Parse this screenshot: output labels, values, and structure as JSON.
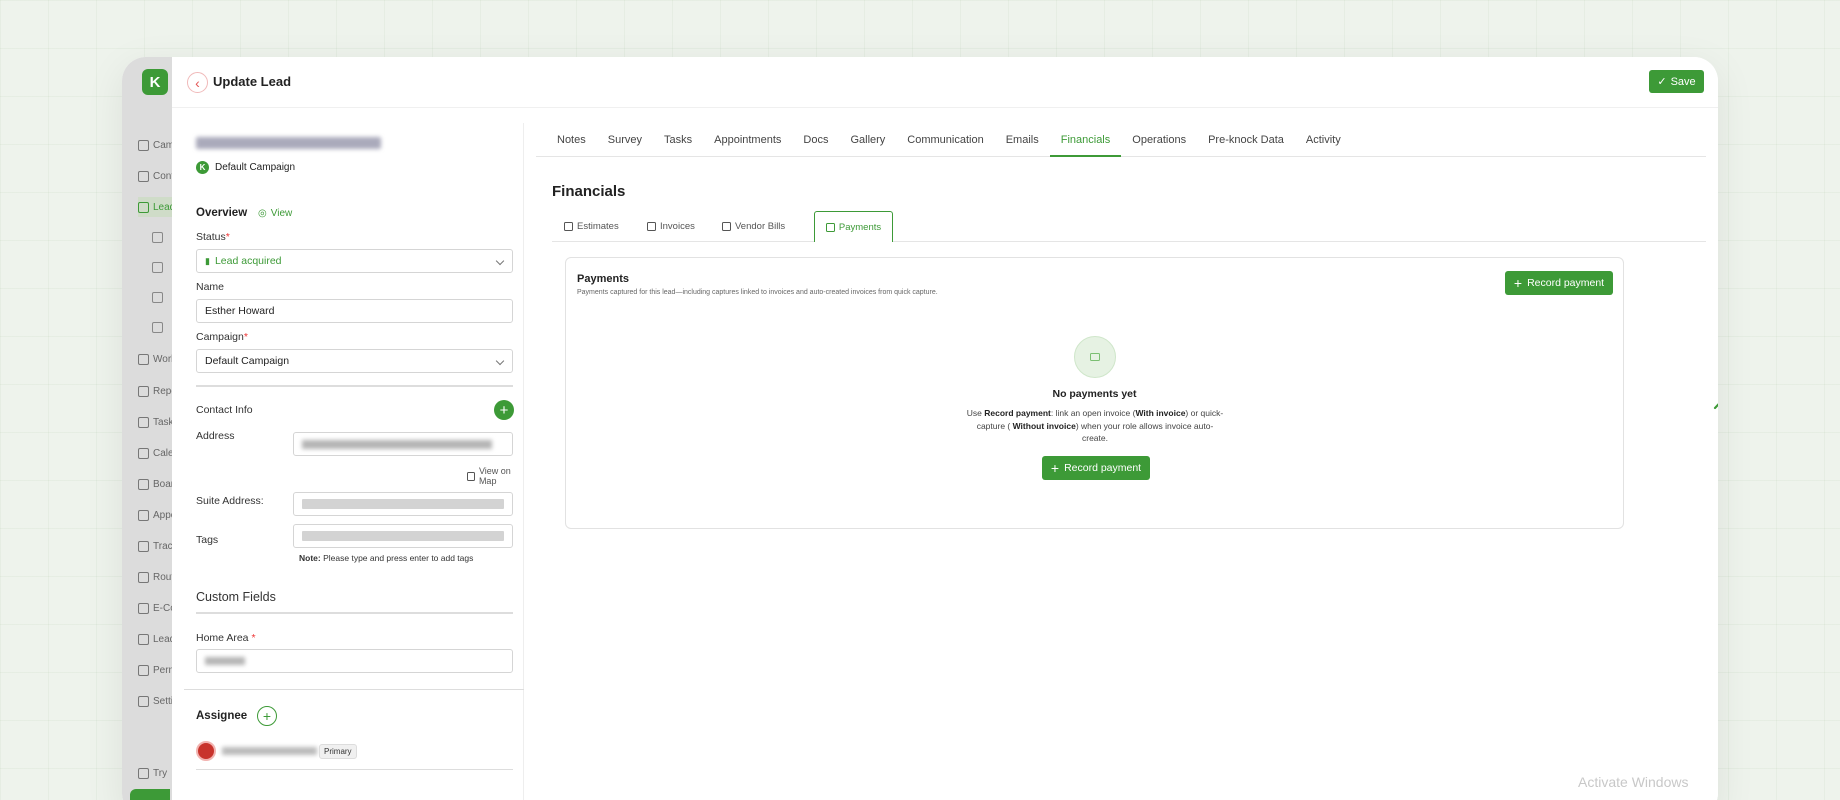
{
  "header": {
    "title": "Update Lead",
    "save_label": "Save"
  },
  "sidebar": {
    "items": [
      {
        "label": "Campaigns"
      },
      {
        "label": "Contacts"
      },
      {
        "label": "Leads"
      },
      {
        "label": "Work Orders"
      },
      {
        "label": "Reports"
      },
      {
        "label": "Tasks"
      },
      {
        "label": "Calendar"
      },
      {
        "label": "Boards"
      },
      {
        "label": "Appointments"
      },
      {
        "label": "Tracking"
      },
      {
        "label": "Routes"
      },
      {
        "label": "E-Contracts"
      },
      {
        "label": "Leaderboard"
      },
      {
        "label": "Permissions"
      },
      {
        "label": "Settings"
      },
      {
        "label": "Try"
      }
    ]
  },
  "lead": {
    "campaign_badge": "Default Campaign",
    "overview_title": "Overview",
    "view_label": "View",
    "status_label": "Status",
    "status_value": "Lead acquired",
    "name_label": "Name",
    "name_value": "Esther Howard",
    "campaign_label": "Campaign",
    "campaign_value": "Default Campaign",
    "contact_info_title": "Contact Info",
    "address_label": "Address",
    "view_on_map": "View on Map",
    "suite_label": "Suite Address:",
    "tags_label": "Tags",
    "tags_note_bold": "Note:",
    "tags_note": "Please type and press enter to add tags",
    "custom_fields_title": "Custom Fields",
    "home_area_label": "Home Area",
    "assignee_title": "Assignee",
    "primary_badge": "Primary"
  },
  "tabs": [
    "Notes",
    "Survey",
    "Tasks",
    "Appointments",
    "Docs",
    "Gallery",
    "Communication",
    "Emails",
    "Financials",
    "Operations",
    "Pre-knock Data",
    "Activity"
  ],
  "active_tab": "Financials",
  "financials": {
    "title": "Financials",
    "subtabs": [
      "Estimates",
      "Invoices",
      "Vendor Bills",
      "Payments"
    ],
    "active_subtab": "Payments",
    "payments": {
      "title": "Payments",
      "description": "Payments captured for this lead—including captures linked to invoices and auto-created invoices from quick capture.",
      "record_label": "Record payment",
      "empty_title": "No payments yet",
      "empty_desc": {
        "p1": "Use ",
        "b1": "Record payment",
        "p2": ": link an open invoice (",
        "b2": "With invoice",
        "p3": ") or quick-capture (",
        "b3": " Without invoice",
        "p4": ") when your role allows invoice auto-create."
      }
    }
  },
  "watermark": "Activate Windows",
  "colors": {
    "accent": "#3d9a37",
    "danger": "#e35353"
  }
}
